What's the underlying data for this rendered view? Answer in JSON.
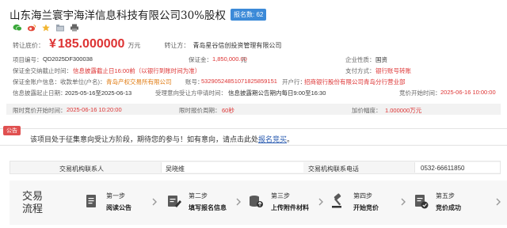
{
  "header": {
    "title": "山东海兰寰宇海洋信息科技有限公司30%股权",
    "badge": "报名数: 62"
  },
  "share_icons": [
    "wechat-icon",
    "weibo-icon",
    "favorite-star-icon",
    "folder-icon",
    "print-icon"
  ],
  "price": {
    "label": "转让底价：",
    "currency": "¥",
    "value": "185.000000",
    "unit": "万元",
    "transferor_label": "转让方：",
    "transferor": "青岛星谷信创投资管理有限公司"
  },
  "info": {
    "project_no_label": "项目编号：",
    "project_no": "QD2025DF300038",
    "deposit_label": "保证金：",
    "deposit": "1,850,000.00",
    "deposit_unit": "元",
    "enterprise_type_label": "企业性质：",
    "enterprise_type": "国资",
    "deposit_deadline_label": "保证金交纳截止时间：",
    "deposit_deadline": "信息披露截止日16:00前（以银行到账时间为准）",
    "pay_method_label": "支付方式：",
    "pay_method": "银行账号转账",
    "account_unit_label": "保证金账户信息：",
    "account_unit_prefix": "收款单位(户名)：",
    "account_unit": "青岛产权交易所有限公司",
    "account_no_label": "账号：",
    "account_no": "53290524851071825859151",
    "bank_label": "开户行：",
    "bank": "招商银行股份有限公司青岛分行营业部",
    "disclosure_label": "信息披露起止日期：",
    "disclosure": "2025-05-16至2025-06-13",
    "accept_label": "受理意向受让方申请时间：",
    "accept": "信息披露期公告期内每日9:00至16:30",
    "bid_time_label": "竞价开始时间：",
    "bid_time": "2025-06-16 10:00:00",
    "limit_start_label": "限时竞价开始时间：",
    "limit_start": "2025-06-16 10:20:00",
    "limit_period_label": "限时报价周期：",
    "limit_period": "60秒",
    "increment_label": "加价幅度：",
    "increment": "1.000000万元"
  },
  "notice": {
    "tag": "公告",
    "text": "该项目处于征集意向受让方阶段，期待您的参与！如有意向，请点击此处",
    "link": "报名竞买",
    "end": "。"
  },
  "contact": {
    "org_contact_label": "交易机构联系人",
    "org_contact": "吴晓维",
    "org_phone_label": "交易机构联系电话",
    "org_phone": "0532-66611850"
  },
  "flow": {
    "title": "交易流程",
    "steps": [
      {
        "num": "第一步",
        "name": "阅读公告",
        "icon": "document-icon"
      },
      {
        "num": "第二步",
        "name": "填写报名信息",
        "icon": "edit-form-icon"
      },
      {
        "num": "第三步",
        "name": "上传附件材料",
        "icon": "upload-icon"
      },
      {
        "num": "第四步",
        "name": "开始竞价",
        "icon": "gavel-icon"
      },
      {
        "num": "第五步",
        "name": "竞价成功",
        "icon": "success-icon"
      }
    ]
  },
  "colors": {
    "accent_red": "#dd3333",
    "accent_orange": "#e07a10",
    "badge_blue": "#3c8ad8",
    "link_blue": "#2a5bb0"
  }
}
